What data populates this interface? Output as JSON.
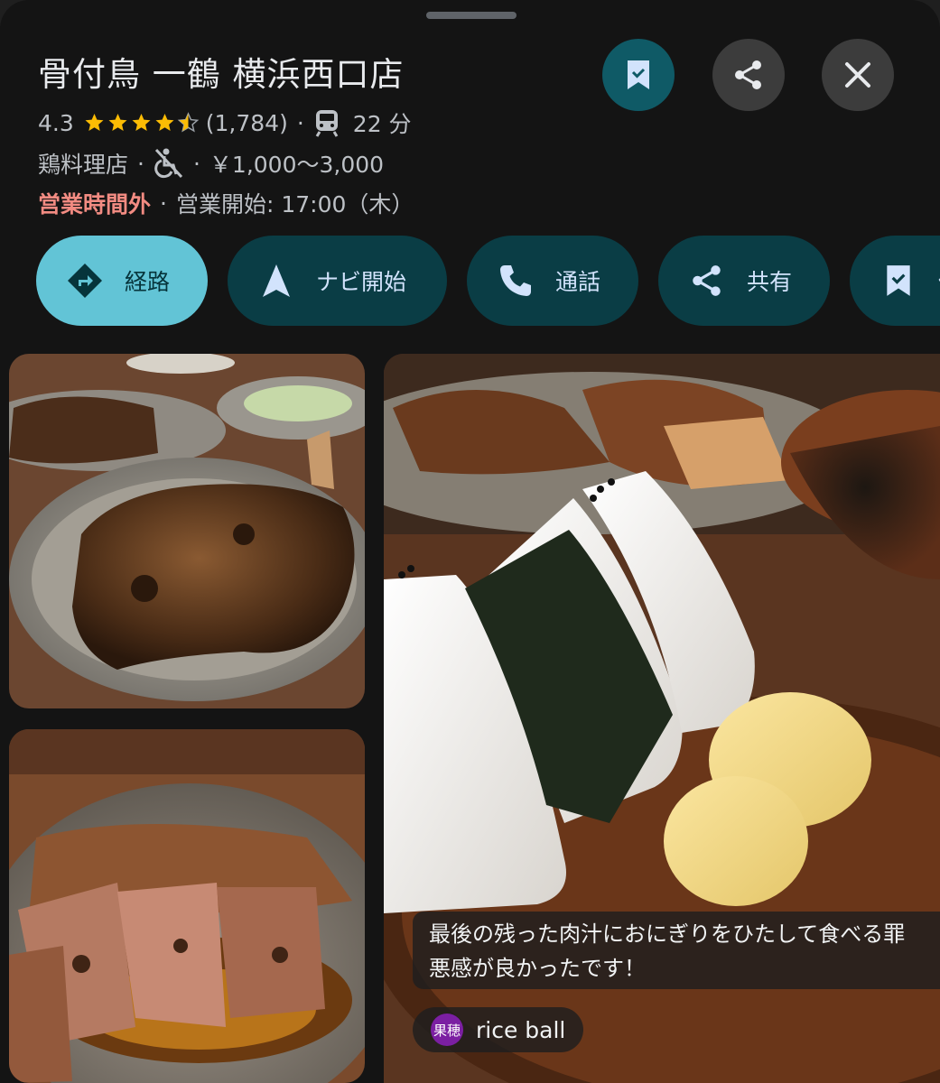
{
  "place": {
    "name": "骨付鳥 一鶴 横浜西口店",
    "rating": "4.3",
    "review_count": "(1,784)",
    "transit_time": "22 分",
    "category": "鶏料理店",
    "price_range": "￥1,000～3,000",
    "status": "営業時間外",
    "opening_info": "営業開始: 17:00（木）"
  },
  "header_buttons": [
    {
      "icon": "bookmark-check-icon"
    },
    {
      "icon": "share-icon"
    },
    {
      "icon": "close-icon"
    }
  ],
  "actions": [
    {
      "label": "経路",
      "icon": "directions-icon"
    },
    {
      "label": "ナビ開始",
      "icon": "navigation-arrow-icon"
    },
    {
      "label": "通話",
      "icon": "phone-icon"
    },
    {
      "label": "共有",
      "icon": "share-icon"
    },
    {
      "label": "保",
      "icon": "bookmark-check-icon"
    }
  ],
  "review": {
    "text": "最後の残った肉汁におにぎりをひたして食べる罪悪感が良かったです！",
    "author_initials": "果穂",
    "author_name": "rice ball"
  },
  "colors": {
    "accent": "#62c4d6",
    "closed_status": "#f28b82",
    "star": "#fbbc04"
  }
}
